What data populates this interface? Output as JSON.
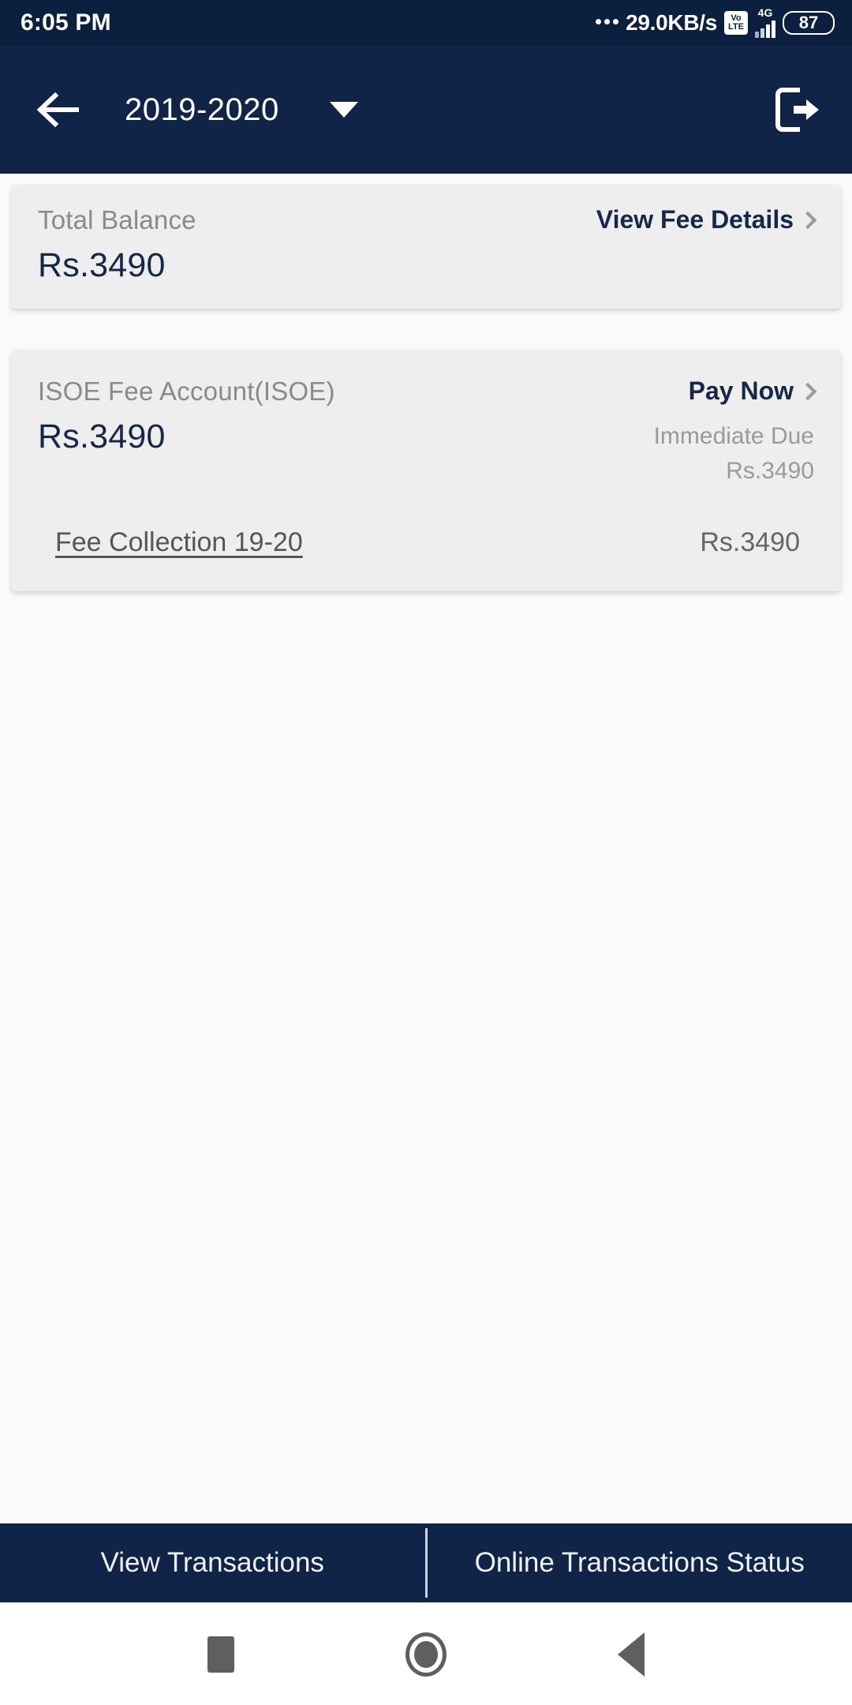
{
  "status_bar": {
    "time": "6:05 PM",
    "network_speed": "29.0KB/s",
    "volte_top": "Vo",
    "volte_bottom": "LTE",
    "network_type": "4G",
    "battery_level": "87"
  },
  "app_bar": {
    "title": "2019-2020",
    "back_icon": "arrow-left-icon",
    "dropdown_icon": "caret-down-icon",
    "logout_icon": "logout-icon"
  },
  "total_balance_card": {
    "label": "Total Balance",
    "amount": "Rs.3490",
    "action_label": "View Fee Details",
    "action_icon": "chevron-right-icon"
  },
  "fee_account_card": {
    "account_name": "ISOE Fee Account(ISOE)",
    "amount": "Rs.3490",
    "action_label": "Pay Now",
    "action_icon": "chevron-right-icon",
    "due_label": "Immediate Due",
    "due_amount": "Rs.3490",
    "fee_items": [
      {
        "name": "Fee Collection 19-20",
        "amount": "Rs.3490"
      }
    ]
  },
  "bottom_bar": {
    "view_transactions_label": "View Transactions",
    "online_status_label": "Online Transactions Status"
  },
  "nav_bar": {
    "recents_icon": "square-icon",
    "home_icon": "circle-icon",
    "back_icon": "triangle-back-icon"
  },
  "colors": {
    "status_bar_bg": "#0b1f3f",
    "app_bar_bg": "#0f2447",
    "page_bg": "#fafafa",
    "card_bg": "#eeeeee",
    "accent_navy": "#16284a",
    "muted_text": "#8a8a8a"
  }
}
